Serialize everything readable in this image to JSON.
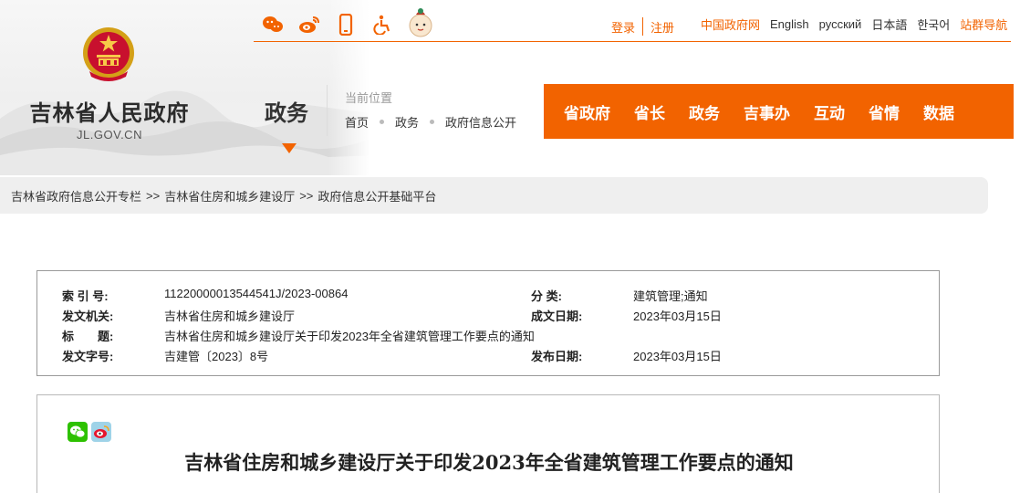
{
  "header": {
    "gov_name": "吉林省人民政府",
    "gov_domain": "JL.GOV.CN",
    "section": "政务",
    "location_label": "当前位置",
    "location_crumbs": [
      "首页",
      "政务",
      "政府信息公开"
    ]
  },
  "toolbar": {
    "icons": [
      "weibo-chat-icon",
      "weibo-icon",
      "mobile-icon",
      "accessibility-icon",
      "mascot-icon"
    ],
    "login": "登录",
    "register": "注册",
    "links": [
      "中国政府网",
      "English",
      "русский",
      "日本語",
      "한국어",
      "站群导航"
    ]
  },
  "nav": {
    "items": [
      "省政府",
      "省长",
      "政务",
      "吉事办",
      "互动",
      "省情",
      "数据"
    ]
  },
  "breadcrumb": {
    "items": [
      "吉林省政府信息公开专栏",
      "吉林省住房和城乡建设厅",
      "政府信息公开基础平台"
    ],
    "separator": ">>"
  },
  "meta": {
    "index_label": "索 引 号:",
    "index_value": "11220000013544541J/2023-00864",
    "category_label": "分 类:",
    "category_value": "建筑管理;通知",
    "issuer_label": "发文机关:",
    "issuer_value": "吉林省住房和城乡建设厅",
    "created_label": "成文日期:",
    "created_value": "2023年03月15日",
    "title_label": "标　　题:",
    "title_value": "吉林省住房和城乡建设厅关于印发2023年全省建筑管理工作要点的通知",
    "docno_label": "发文字号:",
    "docno_value": "吉建管〔2023〕8号",
    "published_label": "发布日期:",
    "published_value": "2023年03月15日"
  },
  "article": {
    "title": "吉林省住房和城乡建设厅关于印发2023年全省建筑管理工作要点的通知",
    "share_icons": [
      "wechat-share-icon",
      "weibo-share-icon"
    ]
  },
  "colors": {
    "accent": "#f26300",
    "nav_bg": "#f26300",
    "crumb_bg": "#efefef"
  }
}
